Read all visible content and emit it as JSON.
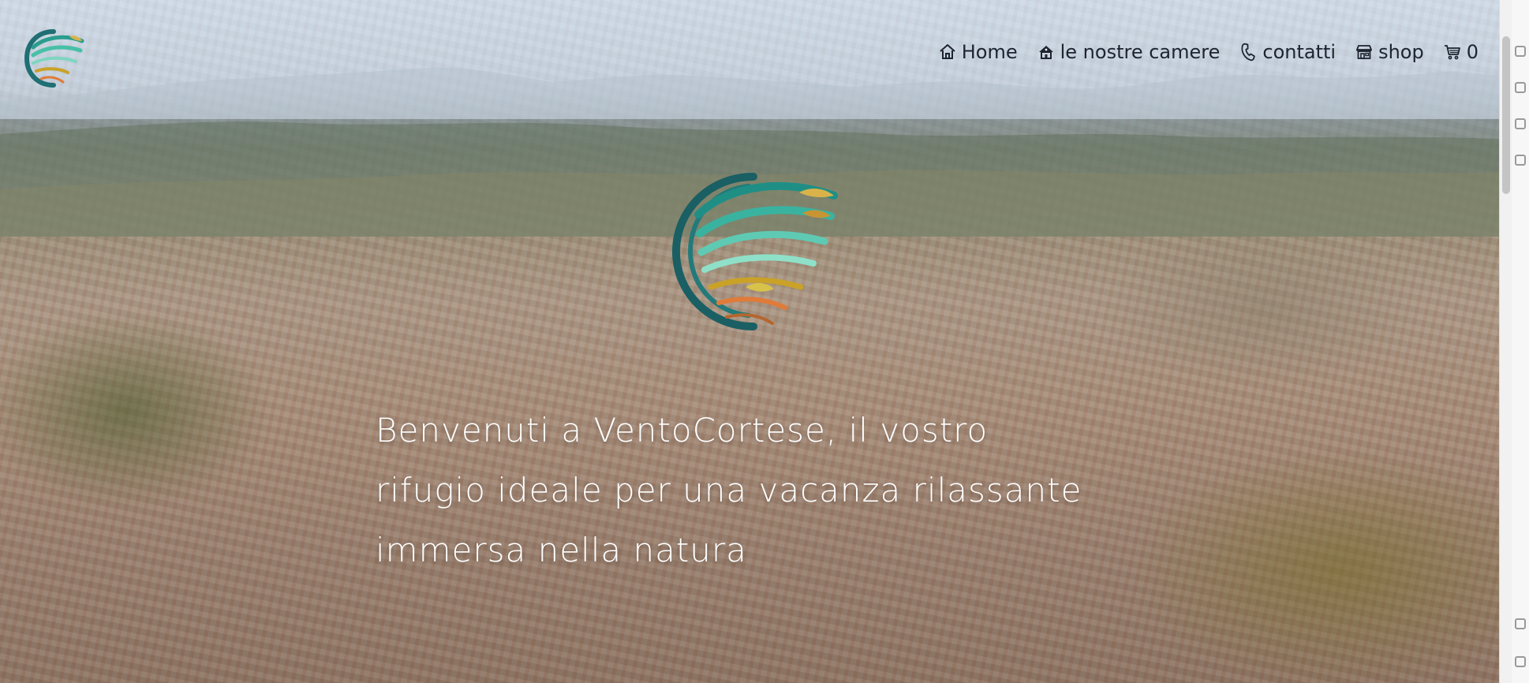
{
  "header": {
    "logo_icon": "vento-cortese-logo-icon"
  },
  "nav": {
    "items": [
      {
        "label": "Home",
        "icon": "home-icon"
      },
      {
        "label": "le nostre camere",
        "icon": "hotel-icon"
      },
      {
        "label": "contatti",
        "icon": "phone-icon"
      },
      {
        "label": "shop",
        "icon": "shop-icon"
      },
      {
        "label": "0",
        "icon": "cart-icon"
      }
    ]
  },
  "hero": {
    "logo_icon": "vento-cortese-emblem-icon",
    "welcome_text": "Benvenuti a VentoCortese, il vostro rifugio ideale per una vacanza rilassante immersa nella natura"
  },
  "colors": {
    "nav_text": "#1d2430",
    "hero_text": "#ffffff",
    "header_overlay": "#d6e2f0"
  }
}
